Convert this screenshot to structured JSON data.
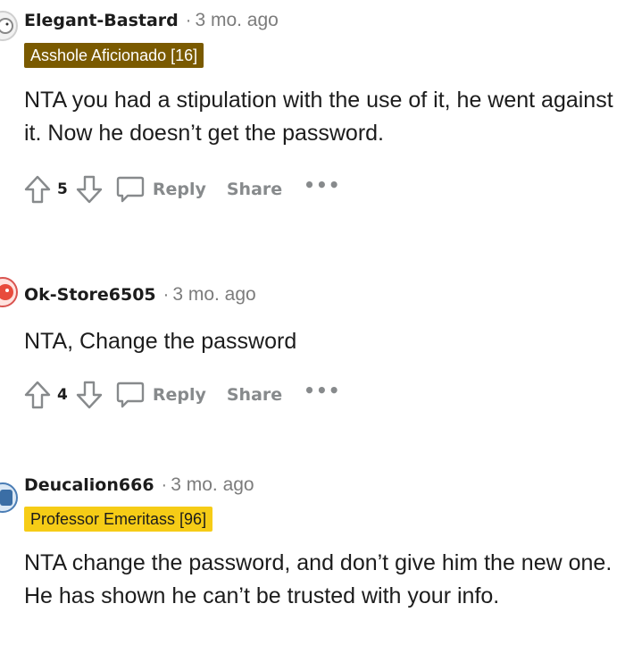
{
  "comments": [
    {
      "author": "Elegant-Bastard",
      "separator": "·",
      "time": "3 mo. ago",
      "flair": "Asshole Aficionado [16]",
      "body": "NTA you had a stipulation with the use of it, he went against it. Now he doesn’t get the password.",
      "votes": "5",
      "reply_label": "Reply",
      "share_label": "Share",
      "more_label": "•••"
    },
    {
      "author": "Ok-Store6505",
      "separator": "·",
      "time": "3 mo. ago",
      "body": "NTA, Change the password",
      "votes": "4",
      "reply_label": "Reply",
      "share_label": "Share",
      "more_label": "•••"
    },
    {
      "author": "Deucalion666",
      "separator": "·",
      "time": "3 mo. ago",
      "flair": "Professor Emeritass [96]",
      "body": "NTA change the password, and don’t give him the new one. He has shown he can’t be trusted with your info."
    }
  ],
  "colors": {
    "flair_dark": "#7a5a00",
    "flair_gold": "#f6cc16",
    "meta_grey": "#7c7c7c",
    "action_grey": "#878a8c"
  },
  "icons": [
    "upvote-arrow-icon",
    "downvote-arrow-icon",
    "comment-bubble-icon",
    "more-options-icon"
  ]
}
